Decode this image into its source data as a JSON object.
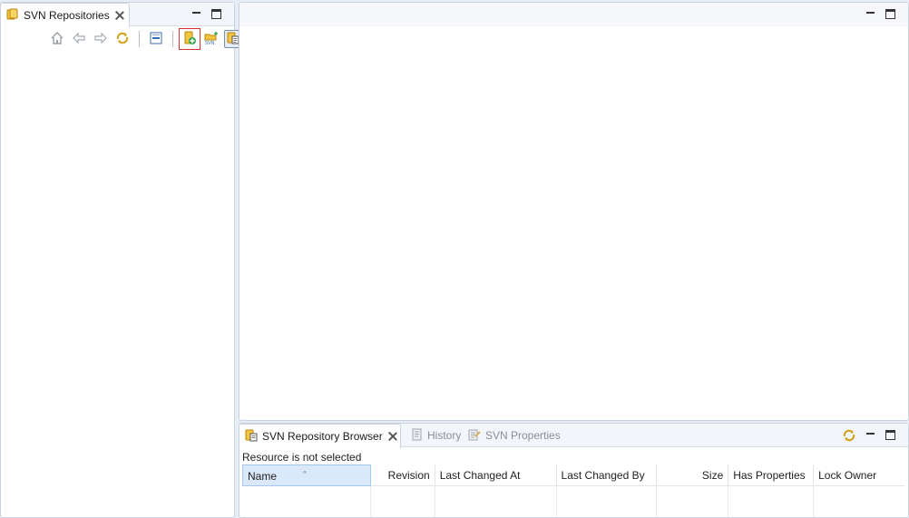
{
  "left_view": {
    "tab_label": "SVN Repositories",
    "toolbar_icons": [
      "home-icon",
      "back-icon",
      "forward-icon",
      "refresh-icon",
      "collapse-all-icon",
      "new-repository-location-icon",
      "import-svn-icon",
      "link-with-editor-icon"
    ]
  },
  "bottom_view": {
    "tabs": [
      {
        "label": "SVN Repository Browser",
        "active": true
      },
      {
        "label": "History",
        "active": false
      },
      {
        "label": "SVN Properties",
        "active": false
      }
    ],
    "status": "Resource is not selected",
    "columns": [
      "Name",
      "Revision",
      "Last Changed At",
      "Last Changed By",
      "Size",
      "Has Properties",
      "Lock Owner"
    ],
    "sorted_column": "Name"
  },
  "colors": {
    "background": "#e8edf5",
    "highlight_border": "#d9342b",
    "sorted_header": "#d9e8fb"
  }
}
